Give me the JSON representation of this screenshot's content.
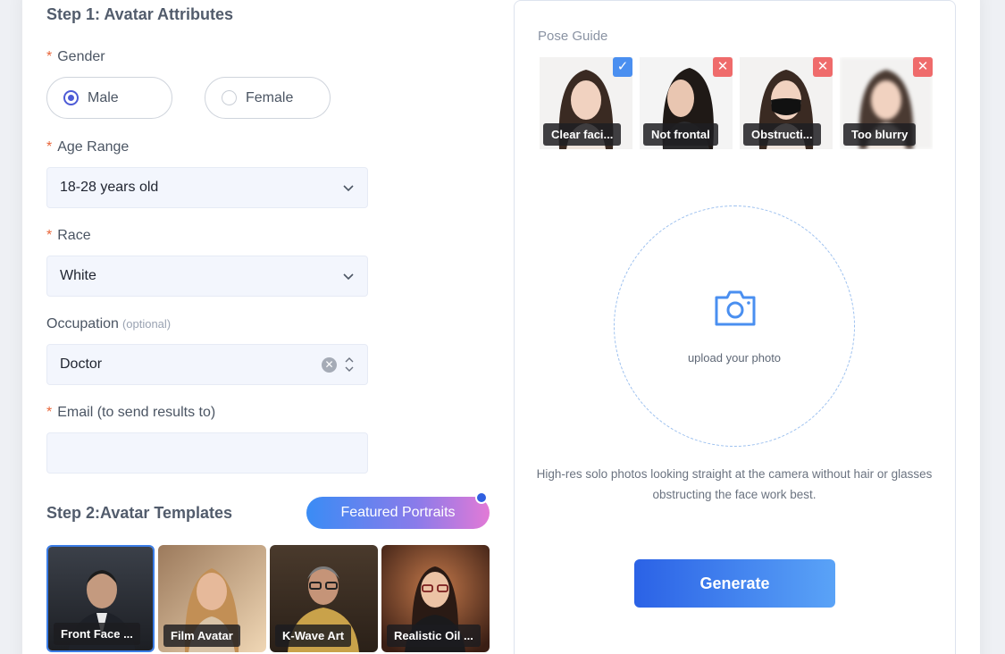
{
  "step1": {
    "title": "Step 1: Avatar Attributes",
    "required_mark": "*",
    "gender": {
      "label": "Gender",
      "options": [
        "Male",
        "Female"
      ],
      "selected": "Male"
    },
    "age": {
      "label": "Age Range",
      "value": "18-28 years old"
    },
    "race": {
      "label": "Race",
      "value": "White"
    },
    "occupation": {
      "label": "Occupation",
      "optional": "(optional)",
      "value": "Doctor"
    },
    "email": {
      "label": "Email (to send results to)",
      "value": ""
    }
  },
  "step2": {
    "title": "Step 2:Avatar Templates",
    "featured_button": "Featured Portraits",
    "templates": [
      "Front Face ...",
      "Film Avatar",
      "K-Wave Art",
      "Realistic Oil ..."
    ],
    "selected": "Front Face ..."
  },
  "pose_guide": {
    "title": "Pose Guide",
    "items": [
      {
        "caption": "Clear faci...",
        "status": "ok"
      },
      {
        "caption": "Not frontal",
        "status": "no"
      },
      {
        "caption": "Obstructi...",
        "status": "no"
      },
      {
        "caption": "Too blurry",
        "status": "no"
      }
    ]
  },
  "upload": {
    "text": "upload your photo",
    "icon": "camera-icon"
  },
  "hint": "High-res solo photos looking straight at the camera without hair or glasses obstructing the face work best.",
  "generate_label": "Generate",
  "colors": {
    "accent": "#2b62e6",
    "required": "#e8663a",
    "ok": "#4a8ff0",
    "no": "#ef6b6b"
  }
}
